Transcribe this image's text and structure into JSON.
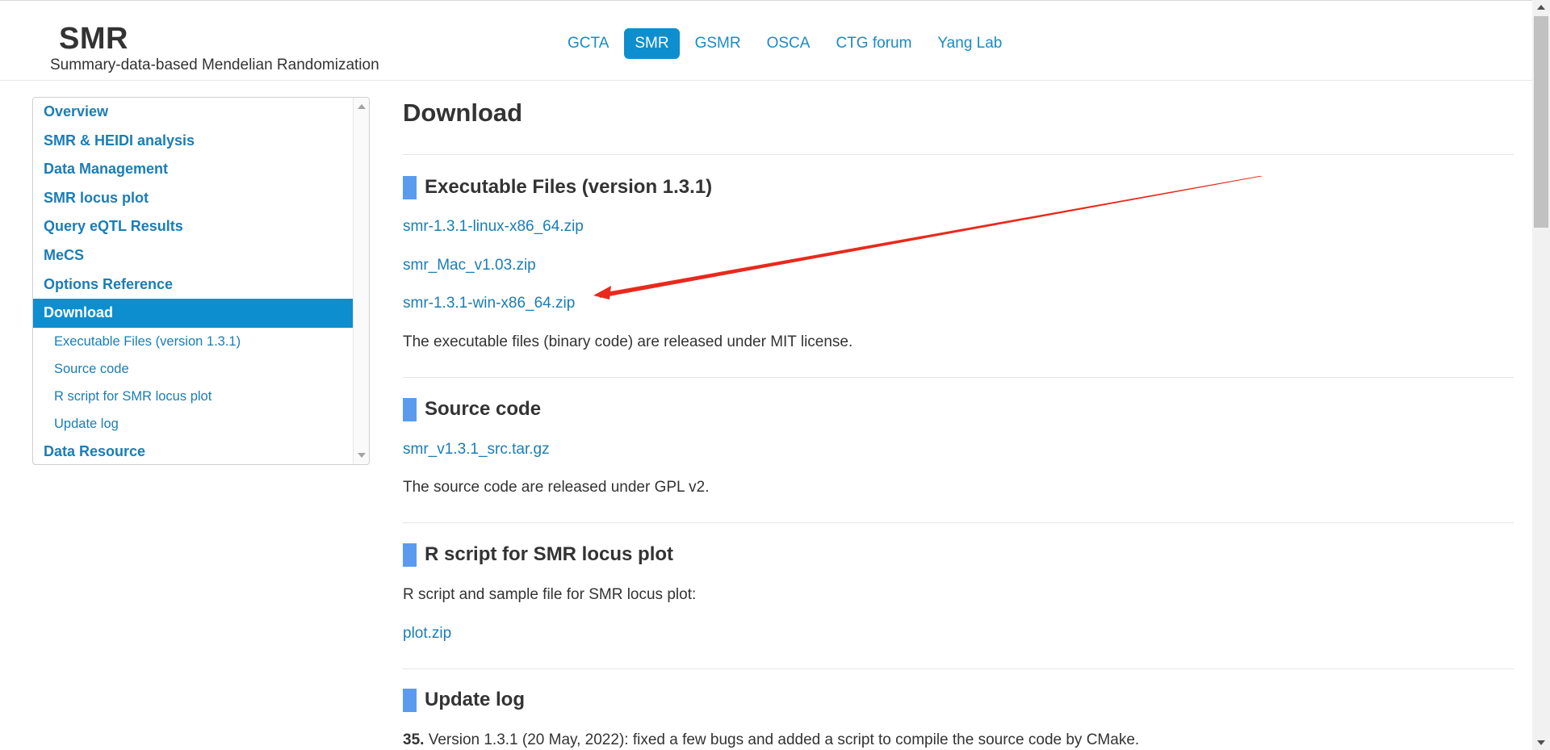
{
  "header": {
    "title": "SMR",
    "subtitle": "Summary-data-based Mendelian Randomization",
    "nav": [
      "GCTA",
      "SMR",
      "GSMR",
      "OSCA",
      "CTG forum",
      "Yang Lab"
    ],
    "active_nav": "SMR"
  },
  "sidebar": {
    "items": [
      {
        "label": "Overview"
      },
      {
        "label": "SMR & HEIDI analysis"
      },
      {
        "label": "Data Management"
      },
      {
        "label": "SMR locus plot"
      },
      {
        "label": "Query eQTL Results"
      },
      {
        "label": "MeCS"
      },
      {
        "label": "Options Reference"
      },
      {
        "label": "Download"
      }
    ],
    "subitems": [
      {
        "label": "Executable Files (version 1.3.1)"
      },
      {
        "label": "Source code"
      },
      {
        "label": "R script for SMR locus plot"
      },
      {
        "label": "Update log"
      }
    ],
    "last_item": {
      "label": "Data Resource"
    }
  },
  "main": {
    "title": "Download",
    "executable": {
      "heading": "Executable Files (version 1.3.1)",
      "links": [
        "smr-1.3.1-linux-x86_64.zip",
        "smr_Mac_v1.03.zip",
        "smr-1.3.1-win-x86_64.zip"
      ],
      "note": "The executable files (binary code) are released under MIT license."
    },
    "source": {
      "heading": "Source code",
      "link": "smr_v1.3.1_src.tar.gz",
      "note": "The source code are released under GPL v2."
    },
    "rscript": {
      "heading": "R script for SMR locus plot",
      "note": "R script and sample file for SMR locus plot:",
      "link": "plot.zip"
    },
    "updatelog": {
      "heading": "Update log",
      "entry_number": "35.",
      "entry_text": " Version 1.3.1 (20 May, 2022): fixed a few bugs and added a script to compile the source code by CMake."
    }
  },
  "annotation": {
    "type": "arrow",
    "color": "#e8291c"
  }
}
